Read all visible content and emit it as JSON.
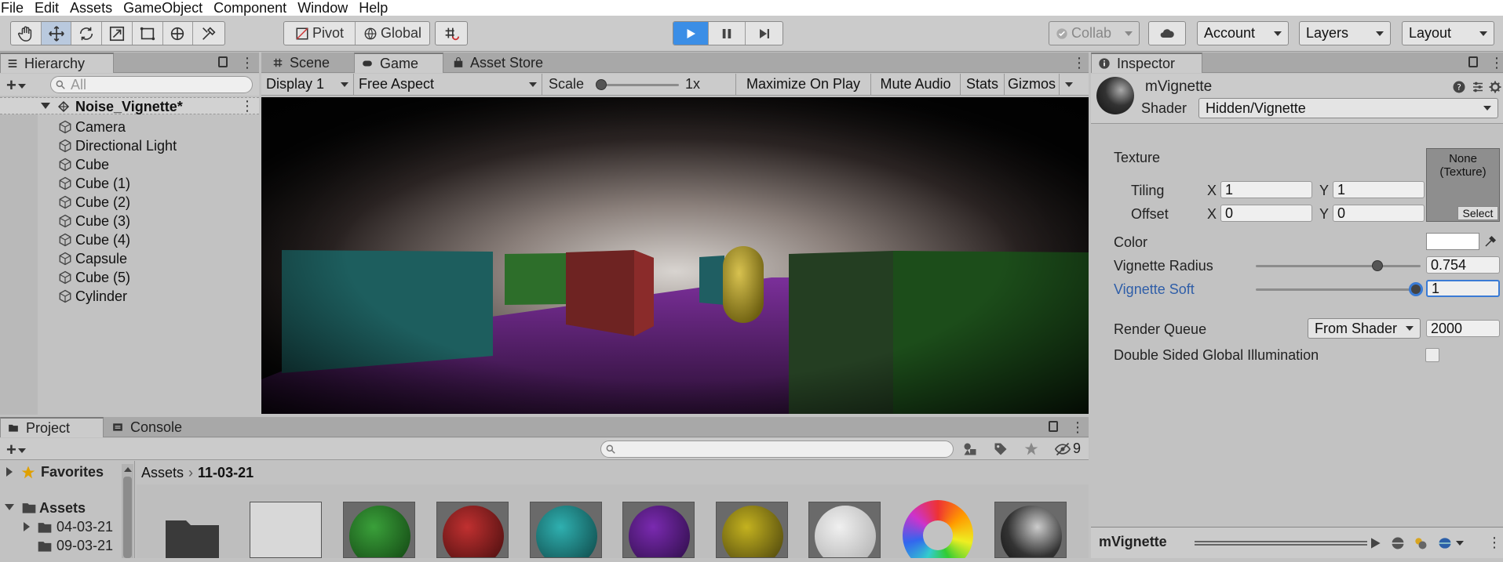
{
  "menu": [
    "File",
    "Edit",
    "Assets",
    "GameObject",
    "Component",
    "Window",
    "Help"
  ],
  "toolbar": {
    "pivot_label": "Pivot",
    "global_label": "Global",
    "collab_label": "Collab",
    "account_label": "Account",
    "layers_label": "Layers",
    "layout_label": "Layout"
  },
  "hierarchy": {
    "tab_label": "Hierarchy",
    "search_placeholder": "All",
    "scene_name": "Noise_Vignette*",
    "items": [
      "Camera",
      "Directional Light",
      "Cube",
      "Cube (1)",
      "Cube (2)",
      "Cube (3)",
      "Cube (4)",
      "Capsule",
      "Cube (5)",
      "Cylinder"
    ]
  },
  "center": {
    "tabs": [
      "Scene",
      "Game",
      "Asset Store"
    ],
    "display": "Display 1",
    "aspect": "Free Aspect",
    "scale_label": "Scale",
    "scale_value": "1x",
    "maximize": "Maximize On Play",
    "mute": "Mute Audio",
    "stats": "Stats",
    "gizmos": "Gizmos"
  },
  "inspector": {
    "tab_label": "Inspector",
    "material_name": "mVignette",
    "shader_label": "Shader",
    "shader_value": "Hidden/Vignette",
    "texture_label": "Texture",
    "tiling_label": "Tiling",
    "offset_label": "Offset",
    "x_label": "X",
    "y_label": "Y",
    "tiling_x": "1",
    "tiling_y": "1",
    "offset_x": "0",
    "offset_y": "0",
    "texture_none": "None",
    "texture_type": "(Texture)",
    "select_label": "Select",
    "color_label": "Color",
    "radius_label": "Vignette Radius",
    "radius_value": "0.754",
    "soft_label": "Vignette Soft",
    "soft_value": "1",
    "render_queue_label": "Render Queue",
    "render_queue_mode": "From Shader",
    "render_queue_value": "2000",
    "double_sided_label": "Double Sided Global Illumination",
    "preview_name": "mVignette"
  },
  "project": {
    "tabs": [
      "Project",
      "Console"
    ],
    "favorites": "Favorites",
    "assets": "Assets",
    "folders": [
      "04-03-21",
      "09-03-21"
    ],
    "breadcrumb_root": "Assets",
    "breadcrumb_current": "11-03-21",
    "hidden_count": "9"
  }
}
